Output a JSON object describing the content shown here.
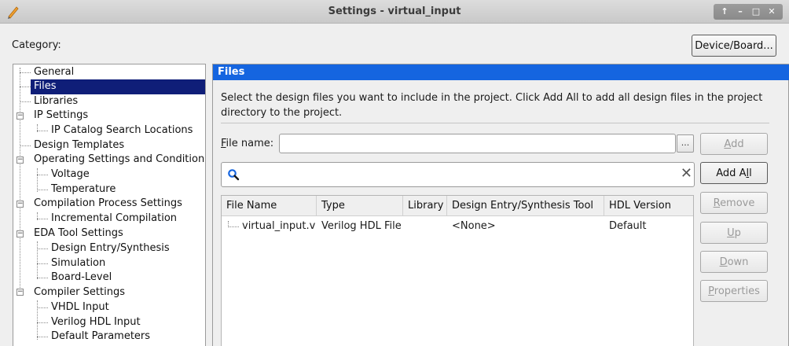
{
  "window": {
    "title": "Settings - virtual_input",
    "controls": [
      "↑",
      "–",
      "□",
      "✕"
    ]
  },
  "category_label": "Category:",
  "device_button": "Device/Board...",
  "tree": {
    "items": [
      {
        "label": "General"
      },
      {
        "label": "Files",
        "selected": true
      },
      {
        "label": "Libraries"
      },
      {
        "label": "IP Settings",
        "expander": "⊟"
      },
      {
        "label": "IP Catalog Search Locations"
      },
      {
        "label": "Design Templates"
      },
      {
        "label": "Operating Settings and Conditions",
        "expander": "⊟"
      },
      {
        "label": "Voltage"
      },
      {
        "label": "Temperature"
      },
      {
        "label": "Compilation Process Settings",
        "expander": "⊟"
      },
      {
        "label": "Incremental Compilation"
      },
      {
        "label": "EDA Tool Settings",
        "expander": "⊟"
      },
      {
        "label": "Design Entry/Synthesis"
      },
      {
        "label": "Simulation"
      },
      {
        "label": "Board-Level"
      },
      {
        "label": "Compiler Settings",
        "expander": "⊟"
      },
      {
        "label": "VHDL Input"
      },
      {
        "label": "Verilog HDL Input"
      },
      {
        "label": "Default Parameters"
      }
    ]
  },
  "panel": {
    "header": "Files",
    "description_line1": "Select the design files you want to include in the project. Click Add All to add all design files in the project",
    "description_line2": "directory to the project.",
    "file_name_label_accel": "F",
    "file_name_label_rest": "ile name:",
    "file_name_value": "",
    "browse_label": "...",
    "search_value": "",
    "clear_glyph": "✕"
  },
  "table": {
    "columns": [
      "File Name",
      "Type",
      "Library",
      "Design Entry/Synthesis Tool",
      "HDL Version"
    ],
    "rows": [
      {
        "file_name": "virtual_input.v",
        "type": "Verilog HDL File",
        "library": "",
        "tool": "<None>",
        "hdl_version": "Default"
      }
    ]
  },
  "buttons": {
    "add": {
      "accel": "A",
      "rest": "dd",
      "enabled": false
    },
    "add_all": {
      "prefix": "Add A",
      "accel": "l",
      "rest": "l",
      "enabled": true
    },
    "remove": {
      "accel": "R",
      "rest": "emove",
      "enabled": false
    },
    "up": {
      "accel": "U",
      "rest": "p",
      "enabled": false
    },
    "down": {
      "accel": "D",
      "rest": "own",
      "enabled": false
    },
    "properties": {
      "accel": "P",
      "rest": "roperties",
      "enabled": false
    }
  },
  "colors": {
    "header_blue": "#1565e0",
    "selection_navy": "#0f1e78",
    "disabled_text": "#9a9a9a"
  }
}
